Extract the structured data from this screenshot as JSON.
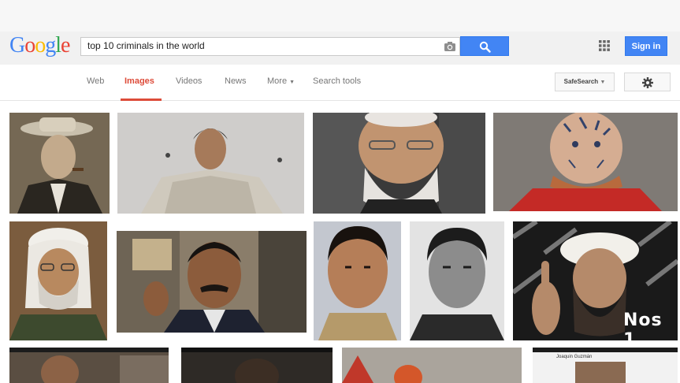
{
  "logo": {
    "text": "Google",
    "letters": [
      "G",
      "o",
      "o",
      "g",
      "l",
      "e"
    ],
    "colors": [
      "#4285f4",
      "#ea4335",
      "#fbbc05",
      "#4285f4",
      "#34a853",
      "#ea4335"
    ]
  },
  "search": {
    "query": "top 10 criminals in the world",
    "camera_icon": "camera-icon",
    "button_icon": "search-icon"
  },
  "header": {
    "apps_icon": "apps-grid-icon",
    "signin_label": "Sign in"
  },
  "nav": {
    "tabs": [
      {
        "label": "Web",
        "active": false
      },
      {
        "label": "Images",
        "active": true
      },
      {
        "label": "Videos",
        "active": false
      },
      {
        "label": "News",
        "active": false
      },
      {
        "label": "More",
        "active": false
      },
      {
        "label": "Search tools",
        "active": false
      }
    ],
    "safesearch_label": "SafeSearch",
    "settings_icon": "gear-icon"
  },
  "results": {
    "overlay_text": "Nos 1",
    "caption_text": "Joaquin Guzmán"
  },
  "colors": {
    "accent_blue": "#4285f4",
    "active_tab": "#dd4b39"
  }
}
